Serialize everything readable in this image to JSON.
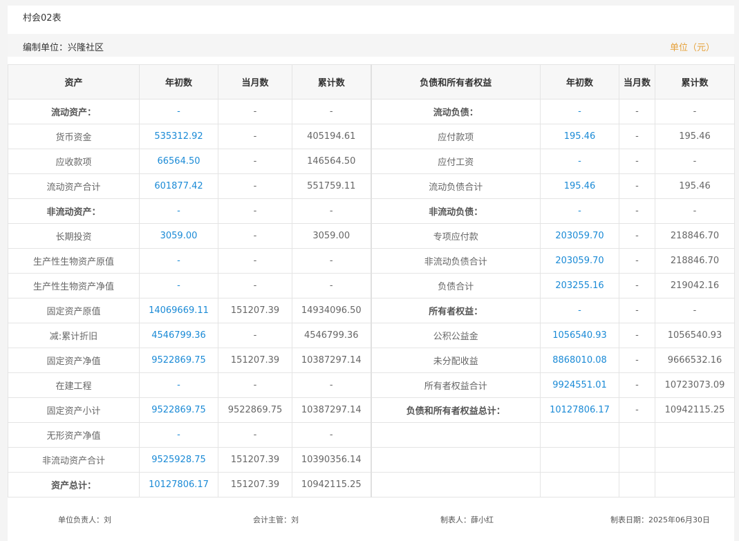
{
  "form_title": "村会02表",
  "unit_bar": {
    "org": "编制单位：兴隆社区",
    "currency": "单位（元）"
  },
  "headers": [
    "资产",
    "年初数",
    "当月数",
    "累计数",
    "负债和所有者权益",
    "年初数",
    "当月数",
    "累计数"
  ],
  "rows": [
    {
      "a_label": "流动资产：",
      "a_bold": true,
      "a_begin": "-",
      "a_month": "-",
      "a_total": "-",
      "l_label": "流动负债：",
      "l_bold": true,
      "l_begin": "-",
      "l_month": "-",
      "l_total": "-"
    },
    {
      "a_label": "货币资金",
      "a_bold": false,
      "a_begin": "535312.92",
      "a_month": "-",
      "a_total": "405194.61",
      "l_label": "应付款项",
      "l_bold": false,
      "l_begin": "195.46",
      "l_month": "-",
      "l_total": "195.46"
    },
    {
      "a_label": "应收款项",
      "a_bold": false,
      "a_begin": "66564.50",
      "a_month": "-",
      "a_total": "146564.50",
      "l_label": "应付工资",
      "l_bold": false,
      "l_begin": "-",
      "l_month": "-",
      "l_total": "-"
    },
    {
      "a_label": "流动资产合计",
      "a_bold": false,
      "a_begin": "601877.42",
      "a_month": "-",
      "a_total": "551759.11",
      "l_label": "流动负债合计",
      "l_bold": false,
      "l_begin": "195.46",
      "l_month": "-",
      "l_total": "195.46"
    },
    {
      "a_label": "非流动资产：",
      "a_bold": true,
      "a_begin": "-",
      "a_month": "-",
      "a_total": "-",
      "l_label": "非流动负债：",
      "l_bold": true,
      "l_begin": "-",
      "l_month": "-",
      "l_total": "-"
    },
    {
      "a_label": "长期投资",
      "a_bold": false,
      "a_begin": "3059.00",
      "a_month": "-",
      "a_total": "3059.00",
      "l_label": "专项应付款",
      "l_bold": false,
      "l_begin": "203059.70",
      "l_month": "-",
      "l_total": "218846.70"
    },
    {
      "a_label": "生产性生物资产原值",
      "a_bold": false,
      "a_begin": "-",
      "a_month": "-",
      "a_total": "-",
      "l_label": "非流动负债合计",
      "l_bold": false,
      "l_begin": "203059.70",
      "l_month": "-",
      "l_total": "218846.70"
    },
    {
      "a_label": "生产性生物资产净值",
      "a_bold": false,
      "a_begin": "-",
      "a_month": "-",
      "a_total": "-",
      "l_label": "负债合计",
      "l_bold": false,
      "l_begin": "203255.16",
      "l_month": "-",
      "l_total": "219042.16"
    },
    {
      "a_label": "固定资产原值",
      "a_bold": false,
      "a_begin": "14069669.11",
      "a_month": "151207.39",
      "a_total": "14934096.50",
      "l_label": "所有者权益：",
      "l_bold": true,
      "l_begin": "-",
      "l_month": "-",
      "l_total": "-"
    },
    {
      "a_label": "减:累计折旧",
      "a_bold": false,
      "a_begin": "4546799.36",
      "a_month": "-",
      "a_total": "4546799.36",
      "l_label": "公积公益金",
      "l_bold": false,
      "l_begin": "1056540.93",
      "l_month": "-",
      "l_total": "1056540.93"
    },
    {
      "a_label": "固定资产净值",
      "a_bold": false,
      "a_begin": "9522869.75",
      "a_month": "151207.39",
      "a_total": "10387297.14",
      "l_label": "未分配收益",
      "l_bold": false,
      "l_begin": "8868010.08",
      "l_month": "-",
      "l_total": "9666532.16"
    },
    {
      "a_label": "在建工程",
      "a_bold": false,
      "a_begin": "-",
      "a_month": "-",
      "a_total": "-",
      "l_label": "所有者权益合计",
      "l_bold": false,
      "l_begin": "9924551.01",
      "l_month": "-",
      "l_total": "10723073.09"
    },
    {
      "a_label": "固定资产小计",
      "a_bold": false,
      "a_begin": "9522869.75",
      "a_month": "9522869.75",
      "a_total": "10387297.14",
      "l_label": "负债和所有者权益总计：",
      "l_bold": true,
      "l_begin": "10127806.17",
      "l_month": "-",
      "l_total": "10942115.25"
    },
    {
      "a_label": "无形资产净值",
      "a_bold": false,
      "a_begin": "-",
      "a_month": "-",
      "a_total": "-",
      "l_label": "",
      "l_bold": false,
      "l_begin": "",
      "l_month": "",
      "l_total": ""
    },
    {
      "a_label": "非流动资产合计",
      "a_bold": false,
      "a_begin": "9525928.75",
      "a_month": "151207.39",
      "a_total": "10390356.14",
      "l_label": "",
      "l_bold": false,
      "l_begin": "",
      "l_month": "",
      "l_total": ""
    },
    {
      "a_label": "资产总计：",
      "a_bold": true,
      "a_begin": "10127806.17",
      "a_month": "151207.39",
      "a_total": "10942115.25",
      "l_label": "",
      "l_bold": false,
      "l_begin": "",
      "l_month": "",
      "l_total": ""
    }
  ],
  "footer": {
    "unit_head": "单位负责人：刘",
    "accounting_head": "会计主管：刘",
    "preparer": "制表人：薛小红",
    "date": "制表日期：2025年06月30日"
  },
  "colors": {
    "link_blue": "#1a8ad6",
    "unit_orange": "#e6a23c"
  }
}
